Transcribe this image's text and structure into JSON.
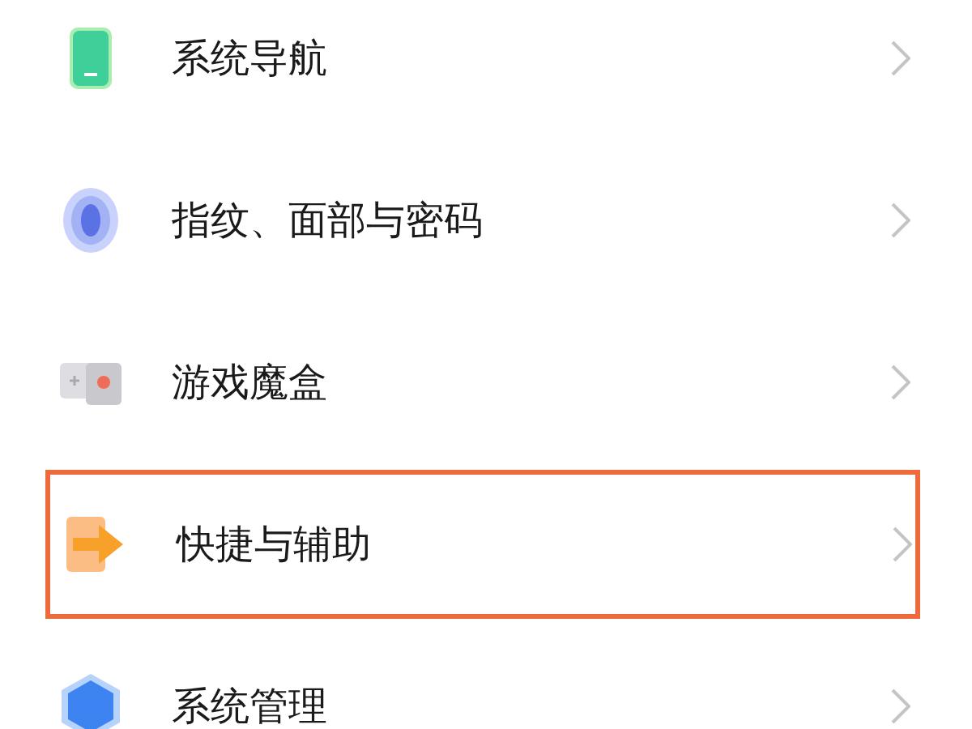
{
  "settings_items": [
    {
      "kind": "phone",
      "label": "系统导航",
      "highlighted": false
    },
    {
      "kind": "fingerprint",
      "label": "指纹、面部与密码",
      "highlighted": false
    },
    {
      "kind": "gamepad",
      "label": "游戏魔盒",
      "highlighted": false
    },
    {
      "kind": "arrow",
      "label": "快捷与辅助",
      "highlighted": true
    },
    {
      "kind": "hexagon",
      "label": "系统管理",
      "highlighted": false
    }
  ]
}
